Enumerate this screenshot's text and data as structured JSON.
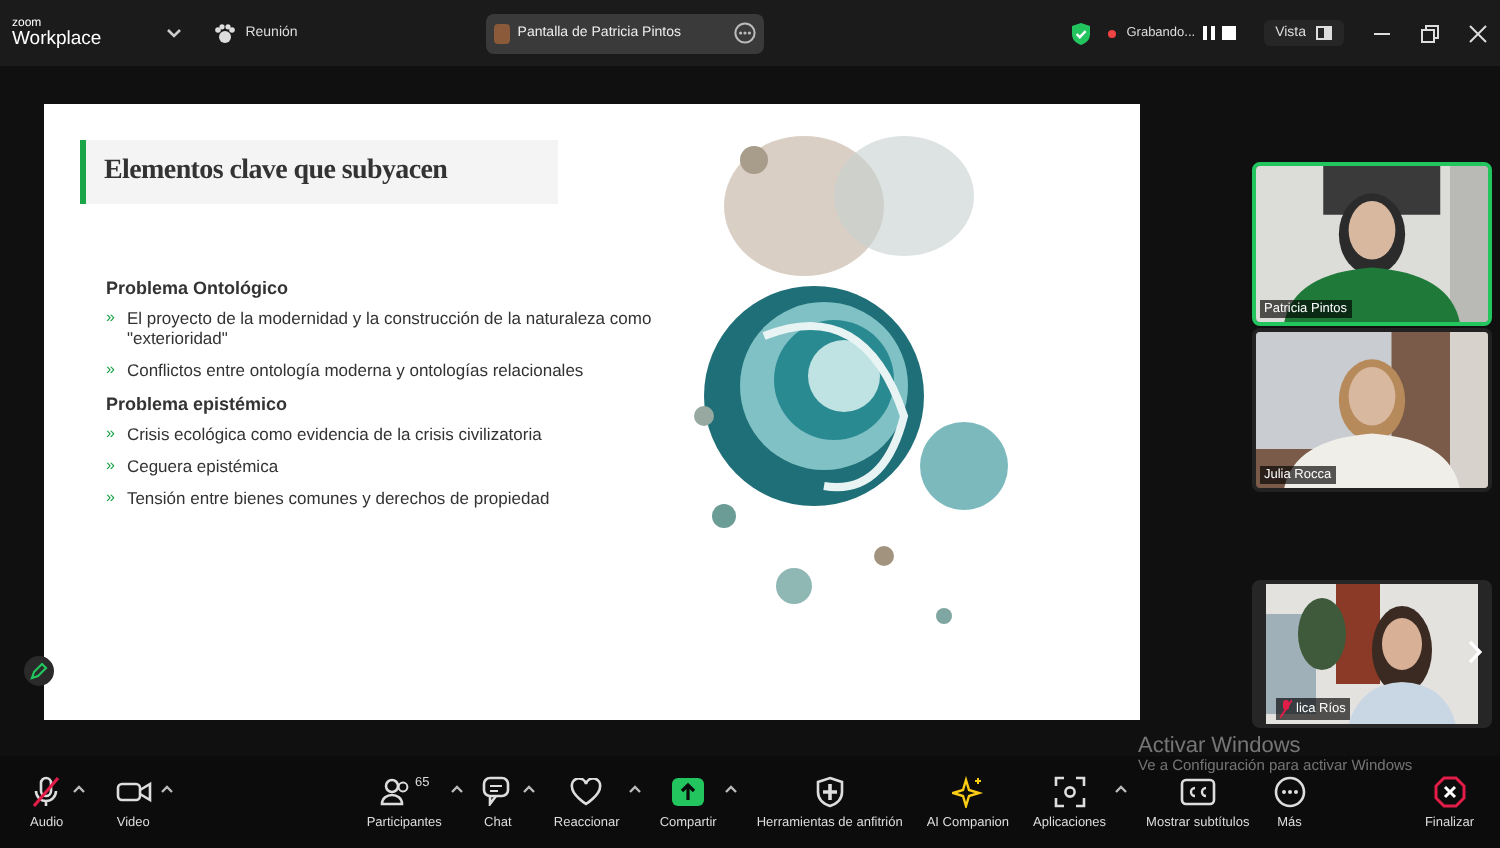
{
  "app": {
    "logo_top": "zoom",
    "logo_bottom": "Workplace"
  },
  "meeting_menu": {
    "label": "Reunión"
  },
  "share_tab": {
    "label": "Pantalla de Patricia Pintos"
  },
  "recording": {
    "label": "Grabando...",
    "on": true
  },
  "view": {
    "label": "Vista"
  },
  "slide": {
    "title": "Elementos clave que subyacen",
    "sections": [
      {
        "heading": "Problema Ontológico",
        "bullets": [
          {
            "marker": "»",
            "text": "El proyecto de la modernidad y la construcción de la naturaleza como \"exterioridad\""
          },
          {
            "marker": "»",
            "text": "Conflictos entre ontología moderna y ontologías relacionales"
          }
        ]
      },
      {
        "heading": "Problema epistémico",
        "bullets": [
          {
            "marker": "»",
            "text": "Crisis ecológica como evidencia de la crisis civilizatoria"
          },
          {
            "marker": "»",
            "text": "Ceguera epistémica"
          },
          {
            "marker": "»",
            "text": "Tensión entre bienes comunes y derechos de propiedad"
          }
        ]
      }
    ]
  },
  "participants": [
    {
      "name": "Patricia Pintos",
      "speaking": true,
      "muted": false
    },
    {
      "name": "Julia Rocca",
      "speaking": false,
      "muted": false
    },
    {
      "name": "lica Ríos",
      "speaking": false,
      "muted": true
    }
  ],
  "toolbar": [
    {
      "kind": "audio",
      "label": "Audio",
      "muted": true,
      "caret": true
    },
    {
      "kind": "video",
      "label": "Video",
      "caret": true
    },
    {
      "kind": "participants",
      "label": "Participantes",
      "count": "65",
      "caret": true
    },
    {
      "kind": "chat",
      "label": "Chat",
      "caret": true
    },
    {
      "kind": "react",
      "label": "Reaccionar",
      "caret": true
    },
    {
      "kind": "share",
      "label": "Compartir",
      "caret": true
    },
    {
      "kind": "host",
      "label": "Herramientas de anfitrión",
      "caret": false
    },
    {
      "kind": "ai",
      "label": "AI Companion",
      "caret": false
    },
    {
      "kind": "apps",
      "label": "Aplicaciones",
      "caret": true
    },
    {
      "kind": "cc",
      "label": "Mostrar subtítulos",
      "caret": false
    },
    {
      "kind": "more",
      "label": "Más",
      "caret": false
    },
    {
      "kind": "end",
      "label": "Finalizar",
      "caret": false
    }
  ],
  "activation_notice": {
    "title": "Activar Windows",
    "text": "Ve a Configuración para activar Windows"
  }
}
